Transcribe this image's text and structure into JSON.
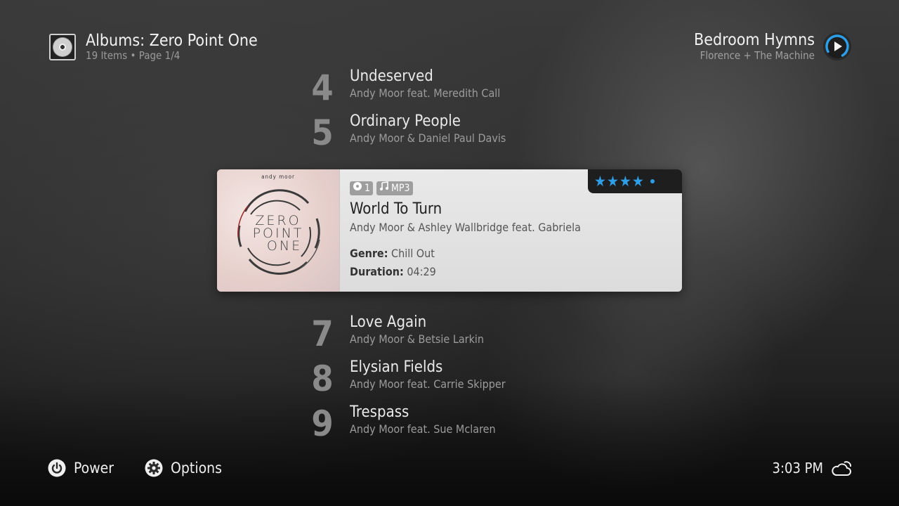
{
  "header": {
    "title": "Albums: Zero Point One",
    "subtitle": "19 Items • Page 1/4",
    "icon": "cd-case-icon"
  },
  "now_playing": {
    "title": "Bedroom Hymns",
    "artist": "Florence + The Machine",
    "icon": "play-icon",
    "accent_color": "#2d9ee8"
  },
  "tracks": [
    {
      "number": "4",
      "title": "Undeserved",
      "artist": "Andy Moor feat. Meredith Call"
    },
    {
      "number": "5",
      "title": "Ordinary People",
      "artist": "Andy Moor & Daniel Paul Davis"
    },
    {
      "number": "7",
      "title": "Love Again",
      "artist": "Andy Moor & Betsie Larkin"
    },
    {
      "number": "8",
      "title": "Elysian Fields",
      "artist": "Andy Moor feat. Carrie Skipper"
    },
    {
      "number": "9",
      "title": "Trespass",
      "artist": "Andy Moor feat. Sue Mclaren"
    }
  ],
  "selected": {
    "cover_brand": "andy moor",
    "cover_words": [
      "ZERO",
      "POINT",
      "ONE"
    ],
    "disc_badge": "1",
    "format_badge": "MP3",
    "title": "World To Turn",
    "artist": "Andy Moor & Ashley Wallbridge feat. Gabriela",
    "genre_label": "Genre:",
    "genre": "Chill Out",
    "duration_label": "Duration:",
    "duration": "04:29",
    "rating": 4,
    "rating_max": 5,
    "rating_color": "#2d9ee8"
  },
  "footer": {
    "power_label": "Power",
    "options_label": "Options",
    "time": "3:03 PM",
    "weather_icon": "cloudy-weather-icon"
  }
}
